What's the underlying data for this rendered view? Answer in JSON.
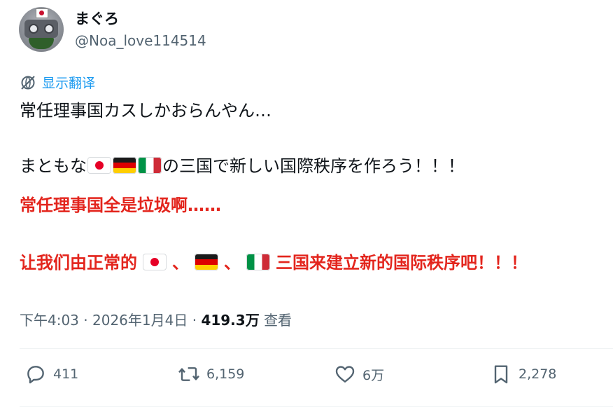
{
  "author": {
    "display_name": "まぐろ",
    "handle": "@Noa_love114514"
  },
  "translate_label": "显示翻译",
  "tweet": {
    "line1": "常任理事国カスしかおらんやん…",
    "line2_before": "まともな",
    "line2_after": "の三国で新しい国際秩序を作ろう！！！"
  },
  "translation": {
    "line1": "常任理事国全是垃圾啊……",
    "line2_before": "让我们由正常的",
    "sep1": "、",
    "sep2": "、",
    "line2_after": "三国来建立新的国际秩序吧！！！"
  },
  "flags": [
    "japan-flag",
    "germany-flag",
    "italy-flag"
  ],
  "meta": {
    "time": "下午4:03",
    "dot1": "·",
    "date": "2026年1月4日",
    "dot2": "·",
    "views": "419.3万",
    "views_label": "查看"
  },
  "actions": {
    "replies": "411",
    "reposts": "6,159",
    "likes": "6万",
    "bookmarks": "2,278"
  },
  "colors": {
    "link": "#1d9bf0",
    "secondary_text": "#536471",
    "translation_red": "#e3251d"
  }
}
